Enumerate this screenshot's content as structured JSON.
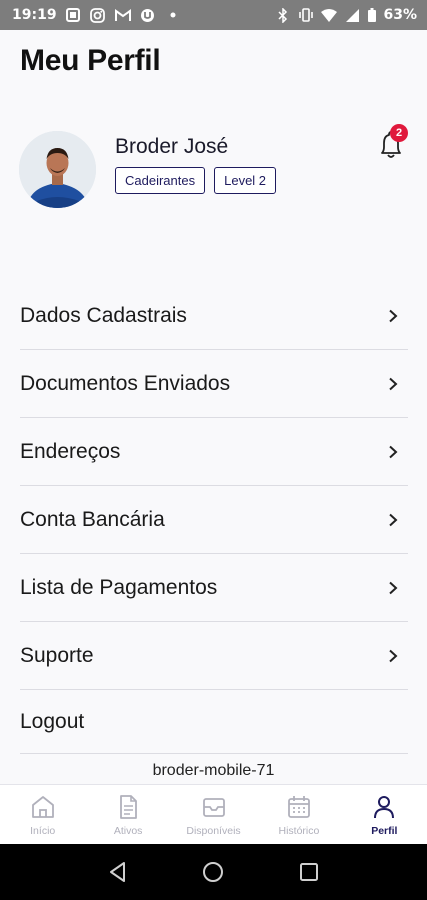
{
  "status_bar": {
    "time": "19:19",
    "left_icons": [
      "notification-icon",
      "instagram-icon",
      "gmail-icon",
      "app-icon",
      "dot-icon"
    ],
    "right_icons": [
      "bluetooth-icon",
      "vibrate-icon",
      "wifi-icon",
      "signal-icon",
      "battery-icon"
    ],
    "battery": "63%"
  },
  "header": {
    "title": "Meu Perfil"
  },
  "profile": {
    "name": "Broder José",
    "badges": [
      "Cadeirantes",
      "Level 2"
    ],
    "notifications_count": "2"
  },
  "menu": {
    "items": [
      {
        "label": "Dados Cadastrais"
      },
      {
        "label": "Documentos Enviados"
      },
      {
        "label": "Endereços"
      },
      {
        "label": "Conta Bancária"
      },
      {
        "label": "Lista de Pagamentos"
      },
      {
        "label": "Suporte"
      }
    ],
    "logout": "Logout"
  },
  "app_version": "broder-mobile-71",
  "tabs": [
    {
      "label": "Início",
      "icon": "home-icon",
      "active": false
    },
    {
      "label": "Ativos",
      "icon": "document-icon",
      "active": false
    },
    {
      "label": "Disponíveis",
      "icon": "inbox-icon",
      "active": false
    },
    {
      "label": "Histórico",
      "icon": "calendar-icon",
      "active": false
    },
    {
      "label": "Perfil",
      "icon": "user-icon",
      "active": true
    }
  ],
  "colors": {
    "accent": "#1e1b5e",
    "badge_red": "#e0193c",
    "inactive": "#b0b0bb"
  }
}
